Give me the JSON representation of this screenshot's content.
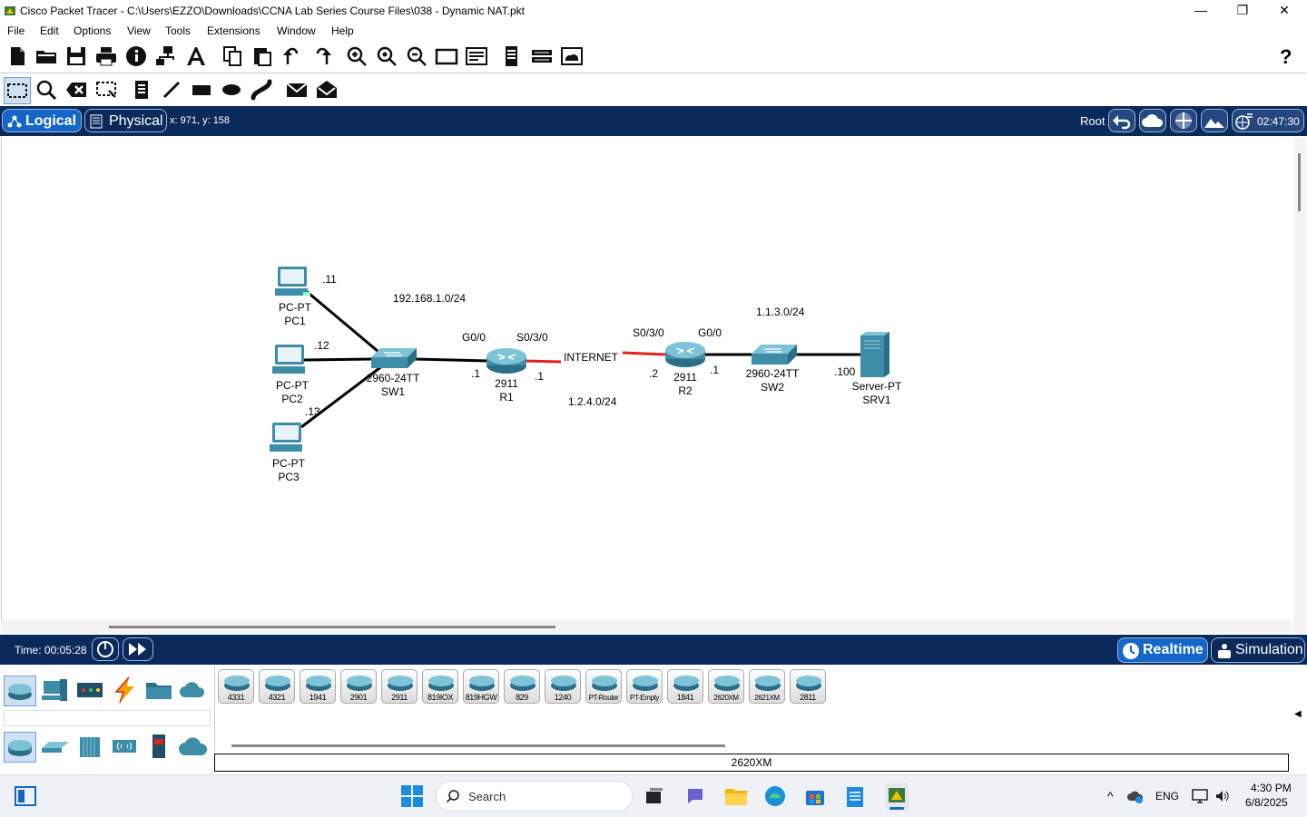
{
  "window": {
    "title": "Cisco Packet Tracer - C:\\Users\\EZZO\\Downloads\\CCNA Lab Series Course Files\\038 - Dynamic NAT.pkt",
    "minimize": "—",
    "restore": "❐",
    "close": "✕"
  },
  "menu": [
    "File",
    "Edit",
    "Options",
    "View",
    "Tools",
    "Extensions",
    "Window",
    "Help"
  ],
  "help_icon": "?",
  "logical_bar": {
    "logical_label": "Logical",
    "physical_label": "Physical",
    "coords": "x: 971, y: 158",
    "root_label": "Root",
    "clock": "02:47:30"
  },
  "topology": {
    "pcs": [
      {
        "model": "PC-PT",
        "name": "PC1",
        "ip": ".11"
      },
      {
        "model": "PC-PT",
        "name": "PC2",
        "ip": ".12"
      },
      {
        "model": "PC-PT",
        "name": "PC3",
        "ip": ".13"
      }
    ],
    "sw1": {
      "model": "2960-24TT",
      "name": "SW1"
    },
    "r1": {
      "model": "2911",
      "name": "R1",
      "lan_if": "G0/0",
      "wan_if": "S0/3/0",
      "lan_ip": ".1",
      "wan_ip": ".1"
    },
    "internet_label": "INTERNET",
    "r2": {
      "model": "2911",
      "name": "R2",
      "wan_if": "S0/3/0",
      "lan_if": "G0/0",
      "wan_ip": ".2",
      "lan_ip": ".1"
    },
    "sw2": {
      "model": "2960-24TT",
      "name": "SW2"
    },
    "srv": {
      "model": "Server-PT",
      "name": "SRV1",
      "ip": ".100"
    },
    "net_lan1": "192.168.1.0/24",
    "net_wan": "1.2.4.0/24",
    "net_lan2": "1.1.3.0/24"
  },
  "sim_bar": {
    "time": "Time: 00:05:28",
    "realtime": "Realtime",
    "simulation": "Simulation"
  },
  "device_models": [
    "4331",
    "4321",
    "1941",
    "2901",
    "2911",
    "819IOX",
    "819HGW",
    "829",
    "1240",
    "PT-Router",
    "PT-Empty",
    "1841",
    "2620XM",
    "2621XM",
    "2811"
  ],
  "selected_model": "2620XM",
  "taskbar": {
    "search_placeholder": "Search",
    "lang": "ENG",
    "time": "4:30 PM",
    "date": "6/8/2025"
  },
  "colors": {
    "bar_bg": "#0b2a5c",
    "accent": "#1566c9",
    "serial_link": "#e0241b",
    "ethernet_link": "#000000"
  }
}
